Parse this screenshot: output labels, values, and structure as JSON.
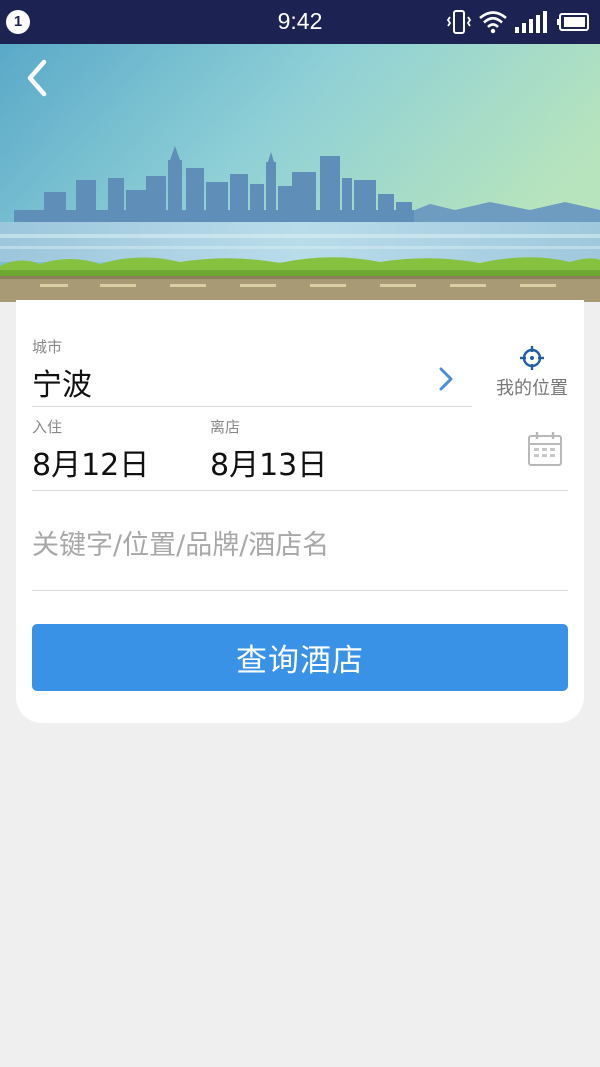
{
  "status_bar": {
    "notification_count": "1",
    "time": "9:42",
    "icons": [
      "vibrate-icon",
      "wifi-icon",
      "signal-icon",
      "battery-icon"
    ]
  },
  "header": {
    "back_icon": "chevron-left-icon"
  },
  "form": {
    "city": {
      "label": "城市",
      "value": "宁波"
    },
    "my_location": {
      "label": "我的位置",
      "icon": "crosshair-icon"
    },
    "checkin": {
      "label": "入住",
      "value": "8月12日"
    },
    "checkout": {
      "label": "离店",
      "value": "8月13日"
    },
    "calendar_icon": "calendar-icon",
    "keyword": {
      "value": "",
      "placeholder": "关键字/位置/品牌/酒店名"
    },
    "search_button": "查询酒店"
  },
  "colors": {
    "status_bar": "#1c2352",
    "accent": "#3a92e6",
    "background": "#efefef"
  }
}
